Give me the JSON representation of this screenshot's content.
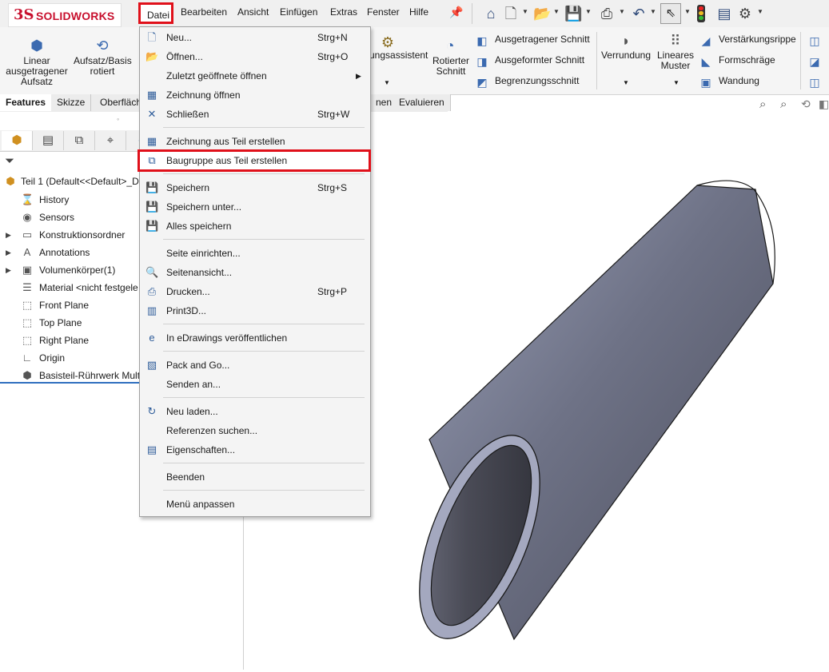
{
  "app": {
    "logo_ds": "3S",
    "logo_text": "SOLIDWORKS"
  },
  "menubar": {
    "items": [
      "Datei",
      "Bearbeiten",
      "Ansicht",
      "Einfügen",
      "Extras",
      "Fenster",
      "Hilfe"
    ]
  },
  "ribbon": {
    "extrude_label": "Linear\nausgetragener\nAufsatz",
    "revolve_label": "Aufsatz/Basis\nrotiert",
    "hole_wizard_label": "ungsassistent",
    "revolved_cut_label": "Rotierter\nSchnitt",
    "extruded_cut_label": "Ausgetragener Schnitt",
    "swept_cut_label": "Ausgeformter Schnitt",
    "boundary_cut_label": "Begrenzungsschnitt",
    "fillet_label": "Verrundung",
    "linear_pattern_label": "Lineares\nMuster",
    "rib_label": "Verstärkungsrippe",
    "draft_label": "Formschräge",
    "shell_label": "Wandung"
  },
  "tabs": {
    "items": [
      "Features",
      "Skizze",
      "Oberfläch",
      "nen",
      "Evaluieren"
    ],
    "active": "Features"
  },
  "feature_tree": {
    "root": "Teil 1  (Default<<Default>_D",
    "items": [
      {
        "label": "History",
        "icon": "history-icon",
        "expandable": false
      },
      {
        "label": "Sensors",
        "icon": "sensor-icon",
        "expandable": false
      },
      {
        "label": "Konstruktionsordner",
        "icon": "folder-icon",
        "expandable": true
      },
      {
        "label": "Annotations",
        "icon": "annotation-icon",
        "expandable": true
      },
      {
        "label": "Volumenkörper(1)",
        "icon": "solid-body-icon",
        "expandable": true
      },
      {
        "label": "Material <nicht festgele",
        "icon": "material-icon",
        "expandable": false
      },
      {
        "label": "Front Plane",
        "icon": "plane-icon",
        "expandable": false
      },
      {
        "label": "Top Plane",
        "icon": "plane-icon",
        "expandable": false
      },
      {
        "label": "Right Plane",
        "icon": "plane-icon",
        "expandable": false
      },
      {
        "label": "Origin",
        "icon": "origin-icon",
        "expandable": false
      },
      {
        "label": "Basisteil-Rührwerk Mult",
        "icon": "feature-icon",
        "expandable": false
      }
    ]
  },
  "file_menu": {
    "groups": [
      [
        {
          "label": "Neu...",
          "shortcut": "Strg+N",
          "icon": "new-file-icon"
        },
        {
          "label": "Öffnen...",
          "shortcut": "Strg+O",
          "icon": "open-folder-icon"
        },
        {
          "label": "Zuletzt geöffnete öffnen",
          "shortcut": "",
          "icon": "",
          "submenu": true
        },
        {
          "label": "Zeichnung öffnen",
          "shortcut": "",
          "icon": "open-drawing-icon"
        },
        {
          "label": "Schließen",
          "shortcut": "Strg+W",
          "icon": "close-file-icon"
        }
      ],
      [
        {
          "label": "Zeichnung aus Teil erstellen",
          "shortcut": "",
          "icon": "drawing-from-part-icon"
        },
        {
          "label": "Baugruppe aus Teil erstellen",
          "shortcut": "",
          "icon": "assembly-from-part-icon",
          "highlighted": true
        }
      ],
      [
        {
          "label": "Speichern",
          "shortcut": "Strg+S",
          "icon": "save-icon"
        },
        {
          "label": "Speichern unter...",
          "shortcut": "",
          "icon": "save-as-icon"
        },
        {
          "label": "Alles speichern",
          "shortcut": "",
          "icon": "save-all-icon"
        }
      ],
      [
        {
          "label": "Seite einrichten...",
          "shortcut": "",
          "icon": ""
        },
        {
          "label": "Seitenansicht...",
          "shortcut": "",
          "icon": "print-preview-icon"
        },
        {
          "label": "Drucken...",
          "shortcut": "Strg+P",
          "icon": "print-icon"
        },
        {
          "label": "Print3D...",
          "shortcut": "",
          "icon": "print3d-icon"
        }
      ],
      [
        {
          "label": "In eDrawings veröffentlichen",
          "shortcut": "",
          "icon": "edrawings-icon"
        }
      ],
      [
        {
          "label": "Pack and Go...",
          "shortcut": "",
          "icon": "pack-and-go-icon"
        },
        {
          "label": "Senden an...",
          "shortcut": "",
          "icon": ""
        }
      ],
      [
        {
          "label": "Neu laden...",
          "shortcut": "",
          "icon": "reload-icon"
        },
        {
          "label": "Referenzen suchen...",
          "shortcut": "",
          "icon": ""
        },
        {
          "label": "Eigenschaften...",
          "shortcut": "",
          "icon": "properties-icon"
        }
      ],
      [
        {
          "label": "Beenden",
          "shortcut": "",
          "icon": ""
        }
      ],
      [
        {
          "label": "Menü anpassen",
          "shortcut": "",
          "icon": ""
        }
      ]
    ]
  },
  "colors": {
    "highlight_border": "#e0101a",
    "brand_red": "#c8102e",
    "tube_light": "#a4a8bf",
    "tube_dark": "#4a4c5a"
  }
}
